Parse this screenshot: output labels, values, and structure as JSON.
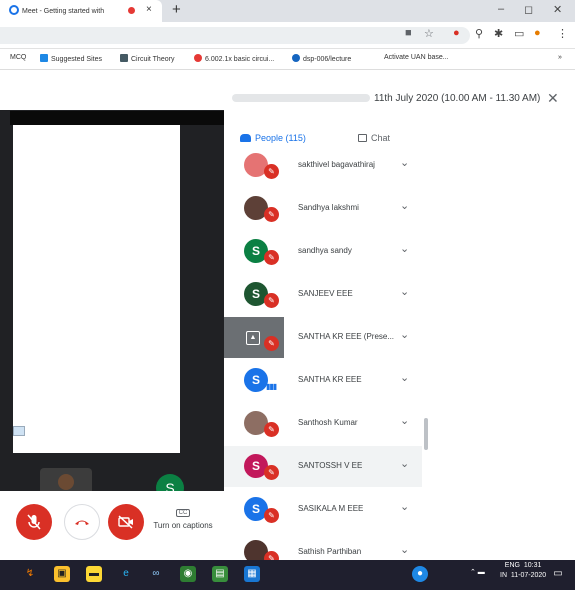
{
  "browser": {
    "tab_title": "Meet - Getting started with",
    "new_tab": "+",
    "window_controls": {
      "minimize": "–",
      "restore": "◻",
      "close": "✕"
    }
  },
  "bookmarks": [
    {
      "label": "MCQ",
      "color": ""
    },
    {
      "label": "Suggested Sites",
      "color": "#1e88e5"
    },
    {
      "label": "Circuit Theory",
      "color": "#455a64"
    },
    {
      "label": "6.002.1x basic circui...",
      "color": "#e53935"
    },
    {
      "label": "dsp-006/lecture",
      "color": "#1565c0"
    },
    {
      "label": "Activate UAN base...",
      "color": ""
    }
  ],
  "meeting": {
    "time_text": "11th July 2020 (10.00 AM - 11.30 AM)",
    "close": "✕"
  },
  "panel": {
    "people_tab": "People (115)",
    "chat_tab": "Chat"
  },
  "participants": [
    {
      "name": "sakthivel bagavathiraj",
      "initial": "",
      "color": "#e57373",
      "status": "muted",
      "highlight": false
    },
    {
      "name": "Sandhya lakshmi",
      "initial": "",
      "color": "#5d4037",
      "status": "muted",
      "highlight": false
    },
    {
      "name": "sandhya sandy",
      "initial": "S",
      "color": "#0b8043",
      "status": "muted",
      "highlight": false
    },
    {
      "name": "SANJEEV EEE",
      "initial": "S",
      "color": "#1e5631",
      "status": "muted",
      "highlight": false
    },
    {
      "name": "SANTHA KR EEE (Prese...",
      "initial": "",
      "color": "#6b6f73",
      "status": "presenting",
      "highlight": false
    },
    {
      "name": "SANTHA KR EEE",
      "initial": "S",
      "color": "#1a73e8",
      "status": "speaking",
      "highlight": false
    },
    {
      "name": "Santhosh Kumar",
      "initial": "",
      "color": "#8d6e63",
      "status": "muted",
      "highlight": false
    },
    {
      "name": "SANTOSSH V EE",
      "initial": "S",
      "color": "#c2185b",
      "status": "muted",
      "highlight": true
    },
    {
      "name": "SASIKALA M EEE",
      "initial": "S",
      "color": "#1a73e8",
      "status": "muted",
      "highlight": false
    },
    {
      "name": "Sathish Parthiban",
      "initial": "",
      "color": "#4e342e",
      "status": "muted",
      "highlight": false
    }
  ],
  "controls": {
    "captions_label": "Turn on captions",
    "captions_icon": "CC"
  },
  "tiles": {
    "tile2_initial": "S"
  },
  "taskbar": {
    "language": "ENG",
    "region": "IN",
    "time": "10:31",
    "date": "11-07-2020"
  },
  "colors": {
    "accent": "#1a73e8",
    "danger": "#d93025"
  }
}
